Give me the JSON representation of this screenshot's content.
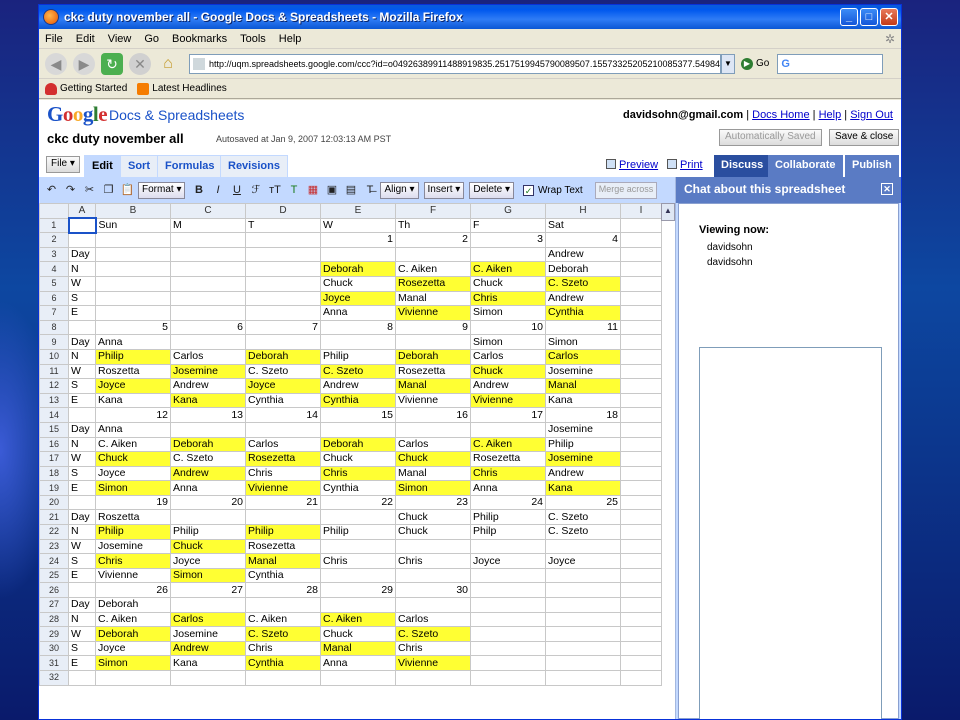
{
  "window": {
    "title": "ckc duty november all - Google Docs & Spreadsheets - Mozilla Firefox"
  },
  "menu": [
    "File",
    "Edit",
    "View",
    "Go",
    "Bookmarks",
    "Tools",
    "Help"
  ],
  "nav": {
    "url": "http://uqm.spreadsheets.google.com/ccc?id=o04926389911488919835.2517519945790089507.15573325205210085377.549843",
    "go_label": "Go",
    "search_value": "G"
  },
  "bookmarks": [
    "Getting Started",
    "Latest Headlines"
  ],
  "header": {
    "logo": [
      "G",
      "o",
      "o",
      "g",
      "l",
      "e"
    ],
    "product": "Docs & Spreadsheets",
    "email": "davidsohn@gmail.com",
    "sep": "|",
    "docs_home": "Docs Home",
    "help": "Help",
    "sign_out": "Sign Out",
    "doc_title": "ckc duty november all",
    "autosave": "Autosaved at Jan 9, 2007 12:03:13 AM PST",
    "auto_saved_btn": "Automatically Saved",
    "save_close_btn": "Save & close"
  },
  "tabs": {
    "file": "File ▾",
    "edit": "Edit",
    "sort": "Sort",
    "formulas": "Formulas",
    "revisions": "Revisions",
    "preview": "Preview",
    "print": "Print",
    "discuss": "Discuss",
    "collaborate": "Collaborate",
    "publish": "Publish"
  },
  "toolbar": {
    "format": "Format ▾",
    "align": "Align ▾",
    "insert": "Insert ▾",
    "delete": "Delete ▾",
    "wrap_text": "Wrap Text",
    "merge": "Merge across"
  },
  "chat": {
    "title": "Chat about this spreadsheet",
    "viewing": "Viewing now:",
    "viewers": [
      "davidsohn",
      "davidsohn"
    ]
  },
  "colors": {
    "highlight": "#ffff33",
    "tab_blue": "#c3d9ff",
    "title_blue": "#0058ee"
  },
  "sheet": {
    "columns": [
      "",
      "A",
      "B",
      "C",
      "D",
      "E",
      "F",
      "G",
      "H",
      "I"
    ],
    "rows": [
      [
        "",
        "Sun",
        "M",
        "T",
        "W",
        "Th",
        "F",
        "Sat",
        ""
      ],
      [
        "",
        "",
        "",
        "",
        "1",
        "2",
        "3",
        "4",
        ""
      ],
      [
        "Day",
        "",
        "",
        "",
        "",
        "",
        "",
        "Andrew",
        ""
      ],
      [
        "N",
        "",
        "",
        "",
        "Deborah",
        "C. Aiken",
        "C. Aiken",
        "Deborah",
        ""
      ],
      [
        "W",
        "",
        "",
        "",
        "Chuck",
        "Rosezetta",
        "Chuck",
        "C. Szeto",
        ""
      ],
      [
        "S",
        "",
        "",
        "",
        "Joyce",
        "Manal",
        "Chris",
        "Andrew",
        ""
      ],
      [
        "E",
        "",
        "",
        "",
        "Anna",
        "Vivienne",
        "Simon",
        "Cynthia",
        ""
      ],
      [
        "",
        "5",
        "6",
        "7",
        "8",
        "9",
        "10",
        "11",
        ""
      ],
      [
        "Day",
        "Anna",
        "",
        "",
        "",
        "",
        "Simon",
        "Simon",
        ""
      ],
      [
        "N",
        "Philip",
        "Carlos",
        "Deborah",
        "Philip",
        "Deborah",
        "Carlos",
        "Carlos",
        ""
      ],
      [
        "W",
        "Roszetta",
        "Josemine",
        "C. Szeto",
        "C. Szeto",
        "Rosezetta",
        "Chuck",
        "Josemine",
        ""
      ],
      [
        "S",
        "Joyce",
        "Andrew",
        "Joyce",
        "Andrew",
        "Manal",
        "Andrew",
        "Manal",
        ""
      ],
      [
        "E",
        "Kana",
        "Kana",
        "Cynthia",
        "Cynthia",
        "Vivienne",
        "Vivienne",
        "Kana",
        ""
      ],
      [
        "",
        "12",
        "13",
        "14",
        "15",
        "16",
        "17",
        "18",
        ""
      ],
      [
        "Day",
        "Anna",
        "",
        "",
        "",
        "",
        "",
        "Josemine",
        ""
      ],
      [
        "N",
        "C. Aiken",
        "Deborah",
        "Carlos",
        "Deborah",
        "Carlos",
        "C. Aiken",
        "Philip",
        ""
      ],
      [
        "W",
        "Chuck",
        "C. Szeto",
        "Rosezetta",
        "Chuck",
        "Chuck",
        "Rosezetta",
        "Josemine",
        ""
      ],
      [
        "S",
        "Joyce",
        "Andrew",
        "Chris",
        "Chris",
        "Manal",
        "Chris",
        "Andrew",
        ""
      ],
      [
        "E",
        "Simon",
        "Anna",
        "Vivienne",
        "Cynthia",
        "Simon",
        "Anna",
        "Kana",
        ""
      ],
      [
        "",
        "19",
        "20",
        "21",
        "22",
        "23",
        "24",
        "25",
        ""
      ],
      [
        "Day",
        "Roszetta",
        "",
        "",
        "",
        "Chuck",
        "Philip",
        "C. Szeto",
        ""
      ],
      [
        "N",
        "Philip",
        "Philip",
        "Philip",
        "Philip",
        "Chuck",
        "Philp",
        "C. Szeto",
        ""
      ],
      [
        "W",
        "Josemine",
        "Chuck",
        "Rosezetta",
        "",
        "",
        "",
        "",
        ""
      ],
      [
        "S",
        "Chris",
        "Joyce",
        "Manal",
        "Chris",
        "Chris",
        "Joyce",
        "Joyce",
        ""
      ],
      [
        "E",
        "Vivienne",
        "Simon",
        "Cynthia",
        "",
        "",
        "",
        "",
        ""
      ],
      [
        "",
        "26",
        "27",
        "28",
        "29",
        "30",
        "",
        "",
        ""
      ],
      [
        "Day",
        "Deborah",
        "",
        "",
        "",
        "",
        "",
        "",
        ""
      ],
      [
        "N",
        "C. Aiken",
        "Carlos",
        "C. Aiken",
        "C. Aiken",
        "Carlos",
        "",
        "",
        ""
      ],
      [
        "W",
        "Deborah",
        "Josemine",
        "C. Szeto",
        "Chuck",
        "C. Szeto",
        "",
        "",
        ""
      ],
      [
        "S",
        "Joyce",
        "Andrew",
        "Chris",
        "Manal",
        "Chris",
        "",
        "",
        ""
      ],
      [
        "E",
        "Simon",
        "Kana",
        "Cynthia",
        "Anna",
        "Vivienne",
        "",
        "",
        ""
      ],
      [
        "",
        "",
        "",
        "",
        "",
        "",
        "",
        "",
        ""
      ]
    ],
    "highlighted": [
      "4-4",
      "4-6",
      "5-5",
      "5-7",
      "6-4",
      "6-6",
      "7-5",
      "7-7",
      "10-1",
      "10-3",
      "10-5",
      "10-7",
      "11-2",
      "11-4",
      "11-6",
      "12-1",
      "12-3",
      "12-5",
      "12-7",
      "13-2",
      "13-4",
      "13-6",
      "16-2",
      "16-4",
      "16-6",
      "17-1",
      "17-3",
      "17-5",
      "17-7",
      "18-2",
      "18-4",
      "18-6",
      "19-1",
      "19-3",
      "19-5",
      "19-7",
      "22-1",
      "22-3",
      "23-2",
      "24-1",
      "24-3",
      "25-2",
      "28-2",
      "28-4",
      "29-1",
      "29-3",
      "29-5",
      "30-2",
      "30-4",
      "31-1",
      "31-3",
      "31-5"
    ]
  }
}
